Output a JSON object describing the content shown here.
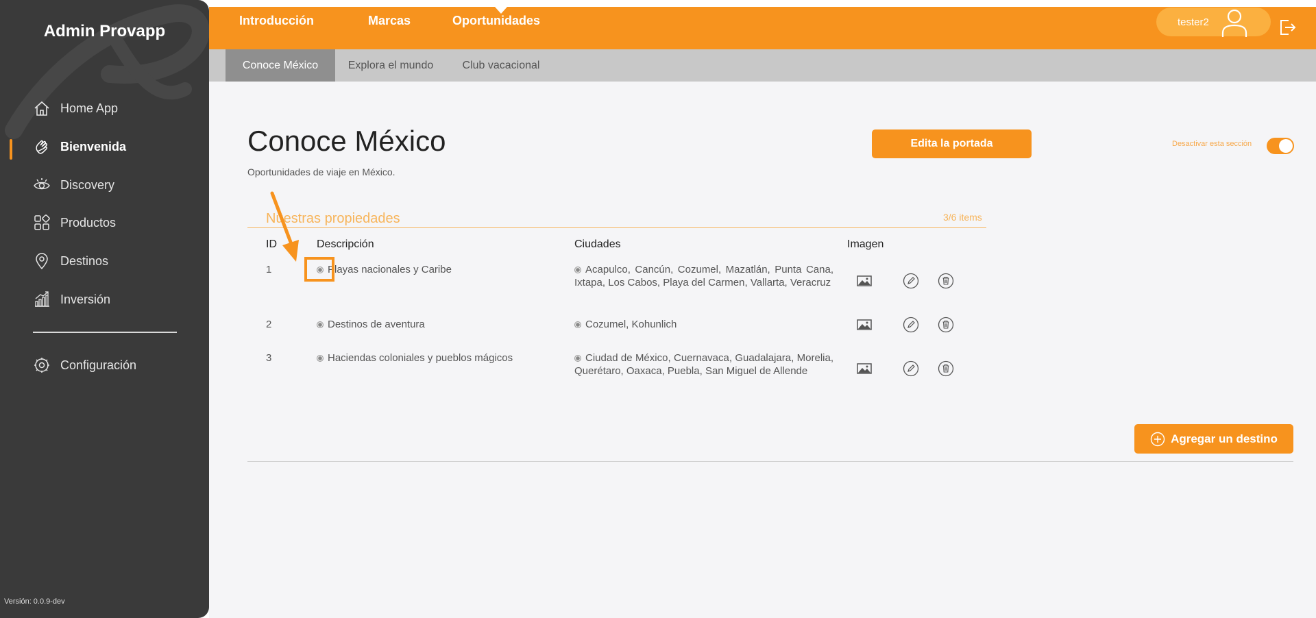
{
  "sidebar": {
    "brand": "Admin Provapp",
    "items": [
      {
        "label": "Home App",
        "icon": "home-icon"
      },
      {
        "label": "Bienvenida",
        "icon": "waving-hand-icon",
        "active": true
      },
      {
        "label": "Discovery",
        "icon": "eye-icon"
      },
      {
        "label": "Productos",
        "icon": "products-grid-icon"
      },
      {
        "label": "Destinos",
        "icon": "location-pin-icon"
      },
      {
        "label": "Inversión",
        "icon": "growth-chart-icon"
      }
    ],
    "config": {
      "label": "Configuración",
      "icon": "settings-gear-icon"
    },
    "version": "Versión: 0.0.9-dev"
  },
  "topnav": {
    "links": [
      "Introducción",
      "Marcas",
      "Oportunidades"
    ],
    "user": "tester2"
  },
  "subnav": {
    "tabs": [
      "Conoce México",
      "Explora el mundo",
      "Club vacacional"
    ],
    "active": "Conoce México"
  },
  "page": {
    "title": "Conoce México",
    "subtitle": "Oportunidades de viaje en México.",
    "edit_cover_label": "Edita la portada",
    "toggle_label": "Desactivar esta sección",
    "toggle_on": true
  },
  "section": {
    "title": "Nuestras propiedades",
    "count": "3/6 items",
    "columns": [
      "ID",
      "Descripción",
      "Ciudades",
      "Imagen"
    ],
    "rows": [
      {
        "id": "1",
        "description": "Playas nacionales y Caribe",
        "cities": "Acapulco, Cancún, Cozumel, Mazatlán, Punta Cana, Ixtapa, Los Cabos, Playa del Carmen, Vallarta, Veracruz"
      },
      {
        "id": "2",
        "description": "Destinos de aventura",
        "cities": "Cozumel, Kohunlich"
      },
      {
        "id": "3",
        "description": "Haciendas coloniales y pueblos mágicos",
        "cities": "Ciudad de México, Cuernavaca, Guadalajara, Morelia, Querétaro, Oaxaca, Puebla, San Miguel de Allende"
      }
    ],
    "add_label": "Agregar un destino"
  },
  "colors": {
    "accent": "#f7931e",
    "sidebar": "#3a3a3a",
    "subnav": "#c8c8c8",
    "subnav_active": "#8f8f8f"
  }
}
